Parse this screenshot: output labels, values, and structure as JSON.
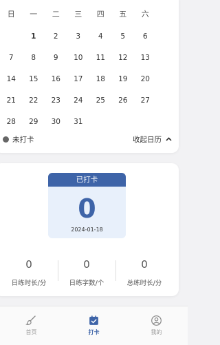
{
  "calendar": {
    "weekdays": [
      "日",
      "一",
      "二",
      "三",
      "四",
      "五",
      "六"
    ],
    "weeks": [
      [
        "",
        "1",
        "2",
        "3",
        "4",
        "5",
        "6"
      ],
      [
        "7",
        "8",
        "9",
        "10",
        "11",
        "12",
        "13"
      ],
      [
        "14",
        "15",
        "16",
        "17",
        "18",
        "19",
        "20"
      ],
      [
        "21",
        "22",
        "23",
        "24",
        "25",
        "26",
        "27"
      ],
      [
        "28",
        "29",
        "30",
        "31",
        "",
        "",
        ""
      ]
    ],
    "legend_label": "未打卡",
    "collapse_label": "收起日历"
  },
  "checkin": {
    "status": "已打卡",
    "count": "0",
    "date": "2024-01-18"
  },
  "stats": [
    {
      "value": "0",
      "label": "日练时长/分"
    },
    {
      "value": "0",
      "label": "日练字数/个"
    },
    {
      "value": "0",
      "label": "总练时长/分"
    }
  ],
  "tabbar": {
    "home": "首页",
    "checkin": "打卡",
    "mine": "我的"
  },
  "colors": {
    "accent": "#3e64a8",
    "badge_bg": "#e8f0fb"
  }
}
